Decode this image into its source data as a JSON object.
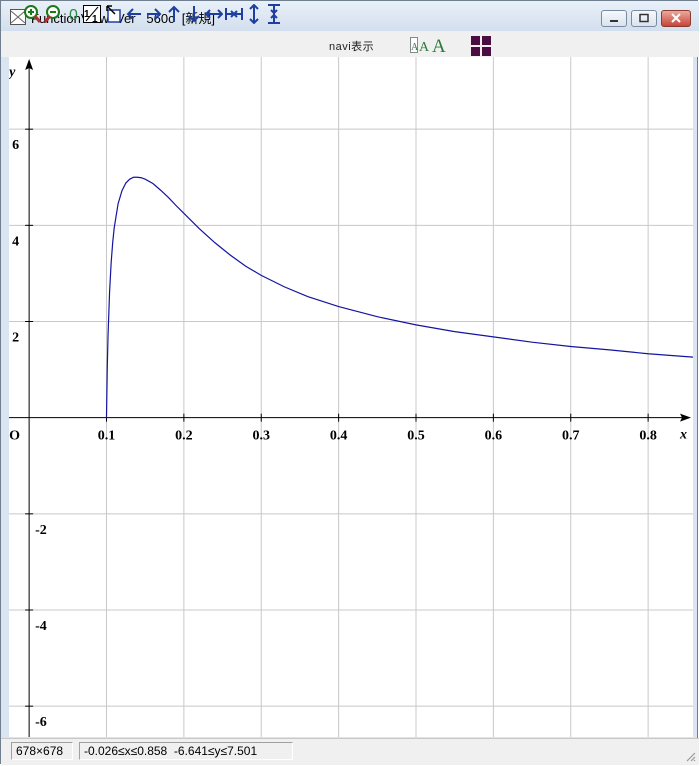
{
  "window": {
    "title": "FunctionView  Ver   560c  [新規]"
  },
  "toolbar": {
    "buttons": [
      {
        "name": "zoom-in-icon"
      },
      {
        "name": "zoom-out-icon"
      },
      {
        "name": "zero-icon"
      },
      {
        "name": "one-to-one-icon"
      },
      {
        "name": "fit-icon"
      },
      {
        "name": "arrow-left-icon"
      },
      {
        "name": "arrow-right-icon"
      },
      {
        "name": "arrow-up-icon"
      },
      {
        "name": "arrow-down-icon"
      },
      {
        "name": "expand-horizontal-icon"
      },
      {
        "name": "shrink-horizontal-icon"
      },
      {
        "name": "expand-vertical-icon"
      },
      {
        "name": "shrink-vertical-icon"
      }
    ],
    "zero_label": "0",
    "navi_label": "navi表示",
    "font_size_label": "AAA",
    "accent_color": "#1f3fa0",
    "grid_button_color": "#4a0f40"
  },
  "chart_data": {
    "type": "line",
    "function_note": "",
    "xlabel": "x",
    "ylabel": "y",
    "origin_label": "O",
    "xlim": [
      -0.026,
      0.858
    ],
    "ylim": [
      -6.641,
      7.501
    ],
    "x_ticks": [
      {
        "value": 0.1,
        "label": "0.1"
      },
      {
        "value": 0.2,
        "label": "0.2"
      },
      {
        "value": 0.3,
        "label": "0.3"
      },
      {
        "value": 0.4,
        "label": "0.4"
      },
      {
        "value": 0.5,
        "label": "0.5"
      },
      {
        "value": 0.6,
        "label": "0.6"
      },
      {
        "value": 0.7,
        "label": "0.7"
      },
      {
        "value": 0.8,
        "label": "0.8"
      }
    ],
    "y_ticks": [
      {
        "value": 6,
        "label": "6"
      },
      {
        "value": 4,
        "label": "4"
      },
      {
        "value": 2,
        "label": "2"
      },
      {
        "value": -2,
        "label": "-2"
      },
      {
        "value": -4,
        "label": "-4"
      },
      {
        "value": -6,
        "label": "-6"
      }
    ],
    "grid": true,
    "series": [
      {
        "color": "#1414a0",
        "points": [
          [
            0.1,
            0
          ],
          [
            0.101,
            1.04
          ],
          [
            0.102,
            1.72
          ],
          [
            0.104,
            2.62
          ],
          [
            0.106,
            3.22
          ],
          [
            0.108,
            3.64
          ],
          [
            0.11,
            3.95
          ],
          [
            0.115,
            4.45
          ],
          [
            0.12,
            4.72
          ],
          [
            0.125,
            4.88
          ],
          [
            0.13,
            4.96
          ],
          [
            0.135,
            5.0
          ],
          [
            0.14,
            5.0
          ],
          [
            0.145,
            4.99
          ],
          [
            0.15,
            4.96
          ],
          [
            0.16,
            4.87
          ],
          [
            0.17,
            4.73
          ],
          [
            0.18,
            4.58
          ],
          [
            0.19,
            4.41
          ],
          [
            0.2,
            4.25
          ],
          [
            0.22,
            3.93
          ],
          [
            0.24,
            3.64
          ],
          [
            0.26,
            3.38
          ],
          [
            0.28,
            3.15
          ],
          [
            0.3,
            2.96
          ],
          [
            0.33,
            2.72
          ],
          [
            0.36,
            2.52
          ],
          [
            0.4,
            2.31
          ],
          [
            0.45,
            2.1
          ],
          [
            0.5,
            1.93
          ],
          [
            0.55,
            1.79
          ],
          [
            0.6,
            1.68
          ],
          [
            0.65,
            1.57
          ],
          [
            0.7,
            1.48
          ],
          [
            0.75,
            1.41
          ],
          [
            0.8,
            1.33
          ],
          [
            0.858,
            1.26
          ]
        ]
      }
    ]
  },
  "status": {
    "size": "678×678",
    "range": "-0.026≤x≤0.858  -6.641≤y≤7.501"
  }
}
